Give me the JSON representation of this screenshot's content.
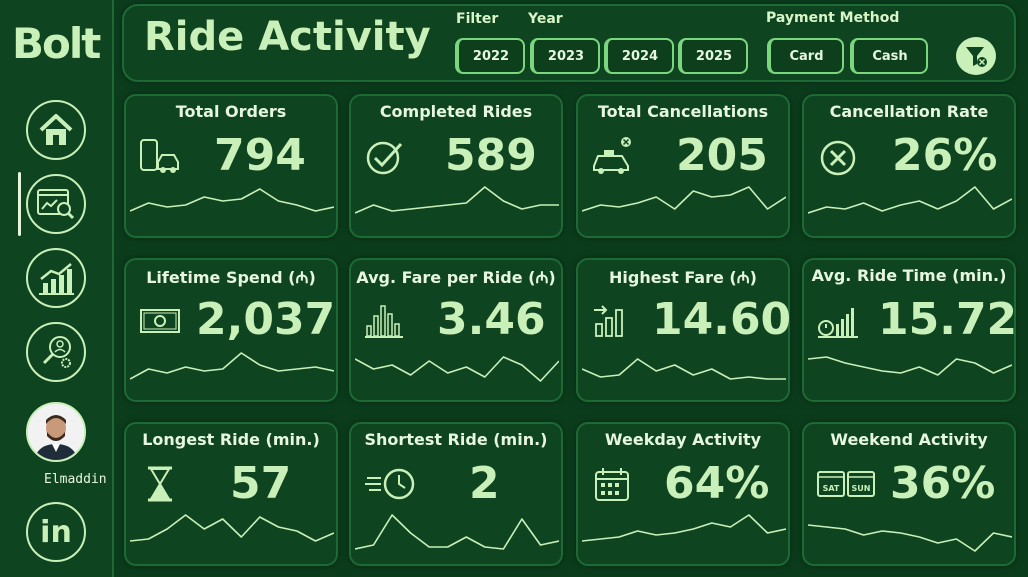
{
  "brand": {
    "logo": "Bolt"
  },
  "sidebar": {
    "items": [
      {
        "name": "home"
      },
      {
        "name": "ride-activity"
      },
      {
        "name": "trends"
      },
      {
        "name": "analysis"
      }
    ],
    "user_name": "Elmaddin",
    "social": "in"
  },
  "header": {
    "title": "Ride Activity",
    "filter_label": "Filter",
    "year_label": "Year",
    "payment_label": "Payment Method",
    "years": [
      "2022",
      "2023",
      "2024",
      "2025"
    ],
    "payments": [
      "Card",
      "Cash"
    ]
  },
  "colors": {
    "background": "#0b3d1c",
    "panel": "#0f4420",
    "accent": "#c9f0b8",
    "border": "#1d6a34"
  },
  "cards": [
    {
      "title": "Total Orders",
      "value": "794",
      "icon": "car-phone-icon",
      "spark": [
        0.35,
        0.55,
        0.45,
        0.5,
        0.7,
        0.6,
        0.65,
        0.9,
        0.6,
        0.5,
        0.35,
        0.45
      ]
    },
    {
      "title": "Completed Rides",
      "value": "589",
      "icon": "check-icon",
      "spark": [
        0.3,
        0.5,
        0.35,
        0.4,
        0.45,
        0.5,
        0.55,
        0.95,
        0.6,
        0.4,
        0.5,
        0.5
      ]
    },
    {
      "title": "Total Cancellations",
      "value": "205",
      "icon": "taxi-cancel-icon",
      "spark": [
        0.35,
        0.5,
        0.45,
        0.55,
        0.7,
        0.4,
        0.85,
        0.7,
        0.75,
        0.95,
        0.4,
        0.7
      ]
    },
    {
      "title": "Cancellation Rate",
      "value": "26%",
      "icon": "cancel-circle-icon",
      "spark": [
        0.3,
        0.45,
        0.4,
        0.55,
        0.35,
        0.5,
        0.6,
        0.4,
        0.6,
        0.95,
        0.4,
        0.65
      ]
    },
    {
      "title": "Lifetime Spend (₼)",
      "value": "2,037",
      "icon": "cash-icon",
      "spark": [
        0.25,
        0.5,
        0.4,
        0.55,
        0.45,
        0.5,
        0.9,
        0.6,
        0.45,
        0.5,
        0.55,
        0.45
      ]
    },
    {
      "title": "Avg. Fare per Ride (₼)",
      "value": "3.46",
      "icon": "bars-icon",
      "spark": [
        0.75,
        0.5,
        0.6,
        0.35,
        0.7,
        0.4,
        0.55,
        0.3,
        0.8,
        0.6,
        0.2,
        0.7
      ]
    },
    {
      "title": "Highest Fare (₼)",
      "value": "14.60",
      "icon": "rising-bars-icon",
      "spark": [
        0.5,
        0.3,
        0.35,
        0.75,
        0.45,
        0.6,
        0.35,
        0.5,
        0.25,
        0.3,
        0.25,
        0.25
      ]
    },
    {
      "title": "Avg. Ride Time (min.)",
      "value": "15.72",
      "icon": "timer-bars-icon",
      "spark": [
        0.75,
        0.8,
        0.65,
        0.55,
        0.45,
        0.4,
        0.55,
        0.35,
        0.75,
        0.65,
        0.4,
        0.6
      ]
    },
    {
      "title": "Longest Ride (min.)",
      "value": "57",
      "icon": "hourglass-icon",
      "spark": [
        0.3,
        0.35,
        0.6,
        0.95,
        0.6,
        0.85,
        0.4,
        0.9,
        0.65,
        0.55,
        0.3,
        0.5
      ]
    },
    {
      "title": "Shortest Ride (min.)",
      "value": "2",
      "icon": "fast-clock-icon",
      "spark": [
        0.1,
        0.2,
        0.95,
        0.5,
        0.15,
        0.15,
        0.4,
        0.15,
        0.1,
        0.85,
        0.2,
        0.3
      ]
    },
    {
      "title": "Weekday Activity",
      "value": "64%",
      "icon": "calendar-icon",
      "spark": [
        0.3,
        0.35,
        0.4,
        0.55,
        0.45,
        0.5,
        0.6,
        0.75,
        0.65,
        0.95,
        0.5,
        0.6
      ]
    },
    {
      "title": "Weekend Activity",
      "value": "36%",
      "icon": "sat-sun-icon",
      "spark": [
        0.7,
        0.65,
        0.6,
        0.45,
        0.55,
        0.5,
        0.4,
        0.25,
        0.35,
        0.05,
        0.5,
        0.4
      ]
    }
  ]
}
